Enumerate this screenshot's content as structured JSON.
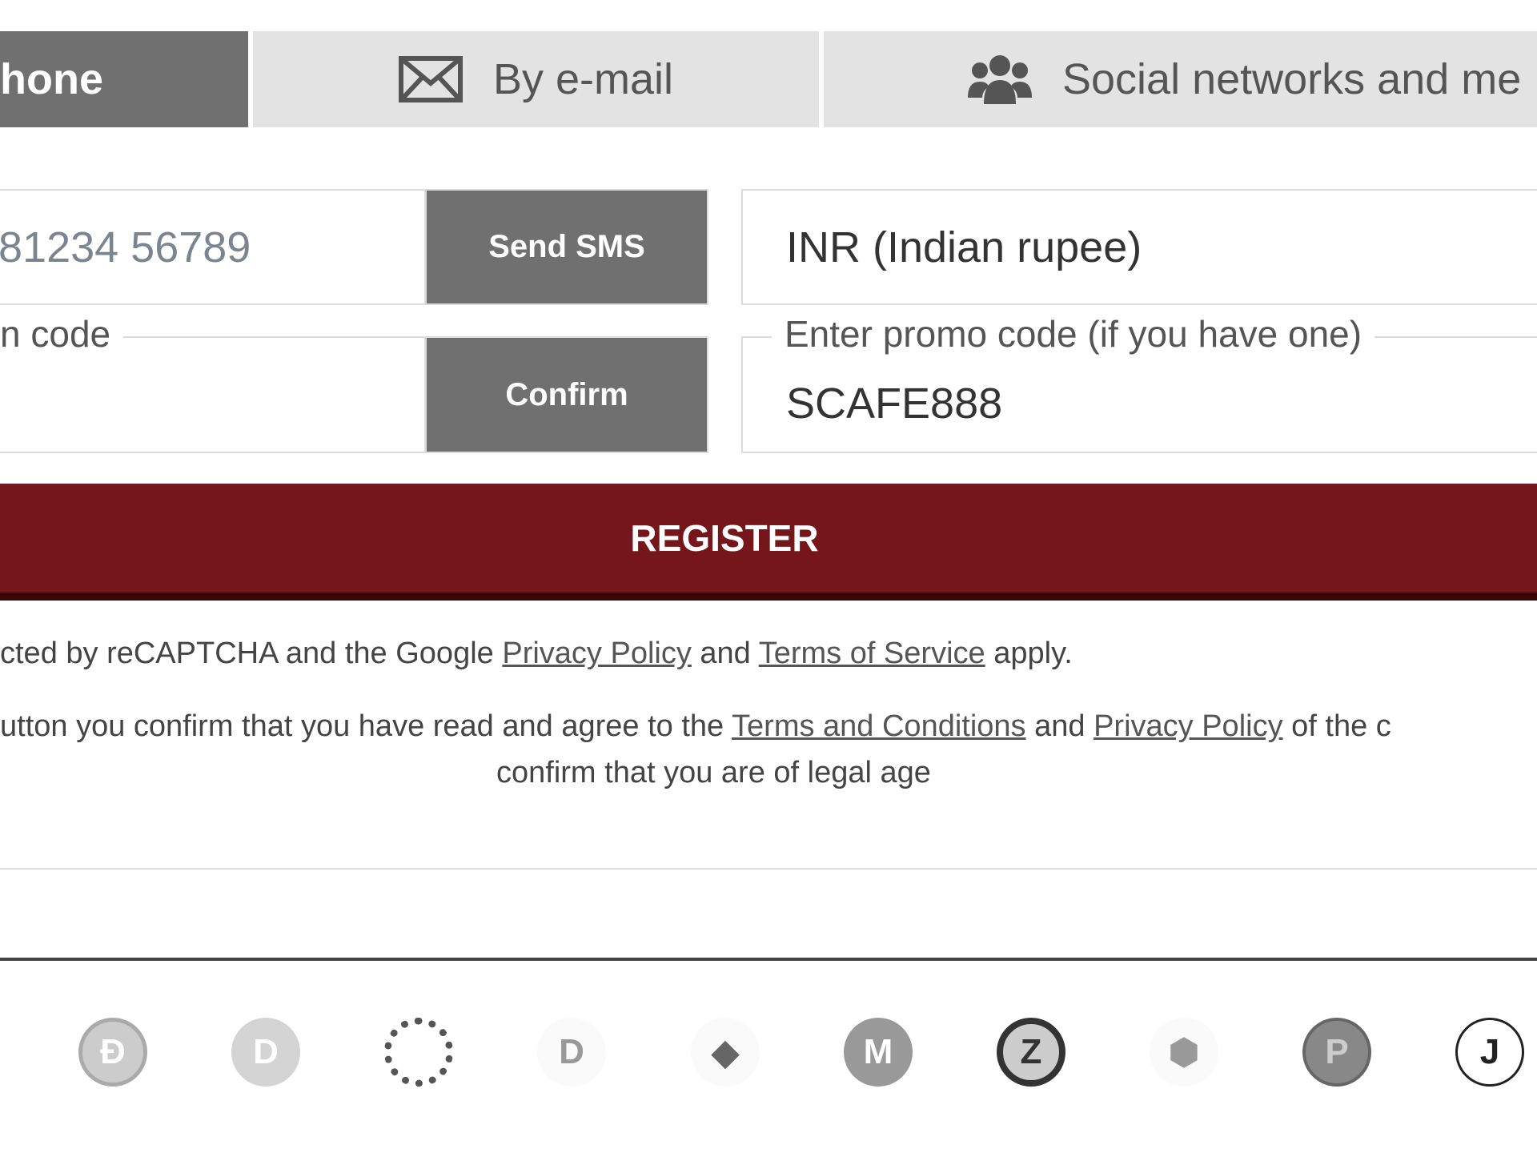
{
  "tabs": [
    {
      "label": "hone",
      "icon": "phone-icon",
      "active": true
    },
    {
      "label": "By e-mail",
      "icon": "envelope-icon",
      "active": false
    },
    {
      "label": "Social networks and me",
      "icon": "users-icon",
      "active": false
    }
  ],
  "phone": {
    "value": "81234 56789",
    "send_label": "Send SMS"
  },
  "confirmation": {
    "legend": "n code",
    "value": "",
    "confirm_label": "Confirm"
  },
  "currency": {
    "value": "INR (Indian rupee)"
  },
  "promo": {
    "legend": "Enter promo code (if you have one)",
    "value": "SCAFE888"
  },
  "register_label": "REGISTER",
  "recaptcha": {
    "prefix": "cted by reCAPTCHA and the Google",
    "privacy_link": "Privacy Policy",
    "and": "and",
    "terms_link": "Terms of Service",
    "suffix": "apply."
  },
  "agreement": {
    "prefix": "utton you confirm that you have read and agree to the",
    "terms_link": "Terms and Conditions",
    "and": "and",
    "privacy_link": "Privacy Policy",
    "suffix": "of the c",
    "line2": "confirm that you are of legal age"
  },
  "colors": {
    "register": "#74161a",
    "tab_active": "#707070",
    "tab_inactive": "#e3e3e3"
  },
  "payment_icons": [
    {
      "name": "dogecoin-icon",
      "glyph": "Ð"
    },
    {
      "name": "dai-icon",
      "glyph": "D"
    },
    {
      "name": "polkadot-icon",
      "glyph": "●"
    },
    {
      "name": "dash-icon",
      "glyph": "D"
    },
    {
      "name": "ethereum-icon",
      "glyph": "◆"
    },
    {
      "name": "monero-icon",
      "glyph": "M"
    },
    {
      "name": "zcash-icon",
      "glyph": "Z"
    },
    {
      "name": "nem-icon",
      "glyph": "⬢"
    },
    {
      "name": "psg-icon",
      "glyph": "P"
    },
    {
      "name": "juventus-icon",
      "glyph": "J"
    }
  ]
}
